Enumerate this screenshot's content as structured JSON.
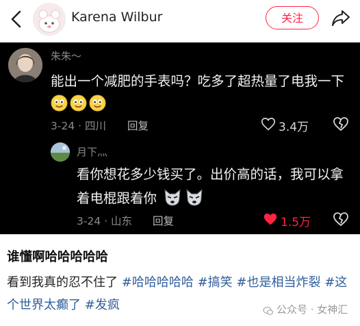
{
  "header": {
    "username": "Karena Wilbur",
    "follow_label": "关注"
  },
  "comment": {
    "author": "朱朱～",
    "text": "能出一个减肥的手表吗？吃多了超热量了电我一下",
    "date_location": "3-24 · 四川",
    "reply_label": "回复",
    "likes": "3.4万",
    "reply": {
      "author": "月下灬",
      "text": "看你想花多少钱买了。出价高的话，我可以拿着电棍跟着你",
      "date_location": "3-24 · 山东",
      "reply_label": "回复",
      "likes": "1.5万",
      "liked": true
    }
  },
  "post": {
    "title": "谁懂啊哈哈哈哈哈",
    "text_prefix": "看到我真的忍不住了 ",
    "tags": [
      "#哈哈哈哈哈",
      "#搞笑",
      "#也是相当炸裂",
      "#这个世界太癫了",
      "#发疯"
    ]
  },
  "watermark": "公众号 · 女神汇",
  "colors": {
    "accent": "#ff2442",
    "tag": "#2f5d9a",
    "panel": "#000000"
  },
  "icons": [
    "back-arrow-icon",
    "share-icon",
    "emoji-icon",
    "wolf-emoji-icon",
    "heart-icon",
    "dislike-icon",
    "wechat-icon"
  ]
}
